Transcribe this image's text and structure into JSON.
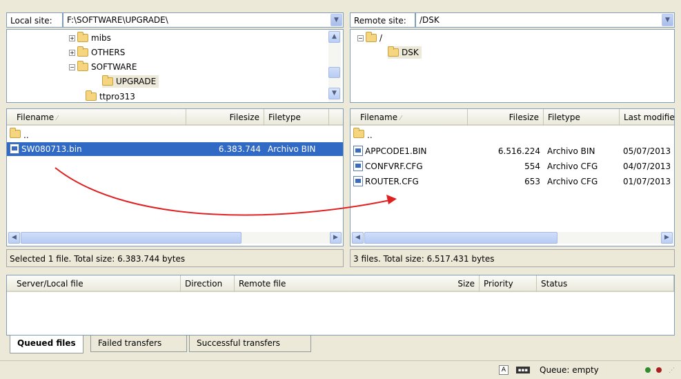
{
  "local": {
    "label": "Local site:",
    "path": "F:\\SOFTWARE\\UPGRADE\\",
    "tree": [
      {
        "label": "mibs",
        "toggle": "+"
      },
      {
        "label": "OTHERS",
        "toggle": "+"
      },
      {
        "label": "SOFTWARE",
        "toggle": "−"
      },
      {
        "label": "UPGRADE",
        "toggle": ""
      },
      {
        "label": "ttpro313",
        "toggle": ""
      }
    ],
    "columns": [
      "Filename",
      "Filesize",
      "Filetype"
    ],
    "rows": [
      {
        "name": "..",
        "size": "",
        "type": ""
      },
      {
        "name": "SW080713.bin",
        "size": "6.383.744",
        "type": "Archivo BIN"
      }
    ],
    "status": "Selected 1 file. Total size: 6.383.744 bytes"
  },
  "remote": {
    "label": "Remote site:",
    "path": "/DSK",
    "tree": [
      {
        "label": "/",
        "toggle": "−"
      },
      {
        "label": "DSK",
        "toggle": ""
      }
    ],
    "columns": [
      "Filename",
      "Filesize",
      "Filetype",
      "Last modifie"
    ],
    "rows": [
      {
        "name": "..",
        "size": "",
        "type": "",
        "modified": ""
      },
      {
        "name": "APPCODE1.BIN",
        "size": "6.516.224",
        "type": "Archivo BIN",
        "modified": "05/07/2013"
      },
      {
        "name": "CONFVRF.CFG",
        "size": "554",
        "type": "Archivo CFG",
        "modified": "04/07/2013"
      },
      {
        "name": "ROUTER.CFG",
        "size": "653",
        "type": "Archivo CFG",
        "modified": "01/07/2013"
      }
    ],
    "status": "3 files. Total size: 6.517.431 bytes"
  },
  "queue": {
    "columns": [
      "Server/Local file",
      "Direction",
      "Remote file",
      "Size",
      "Priority",
      "Status"
    ],
    "tabs": [
      "Queued files",
      "Failed transfers",
      "Successful transfers"
    ],
    "status": "Queue: empty"
  },
  "colors": {
    "selection": "#316ac5",
    "arrow": "#e02020"
  }
}
